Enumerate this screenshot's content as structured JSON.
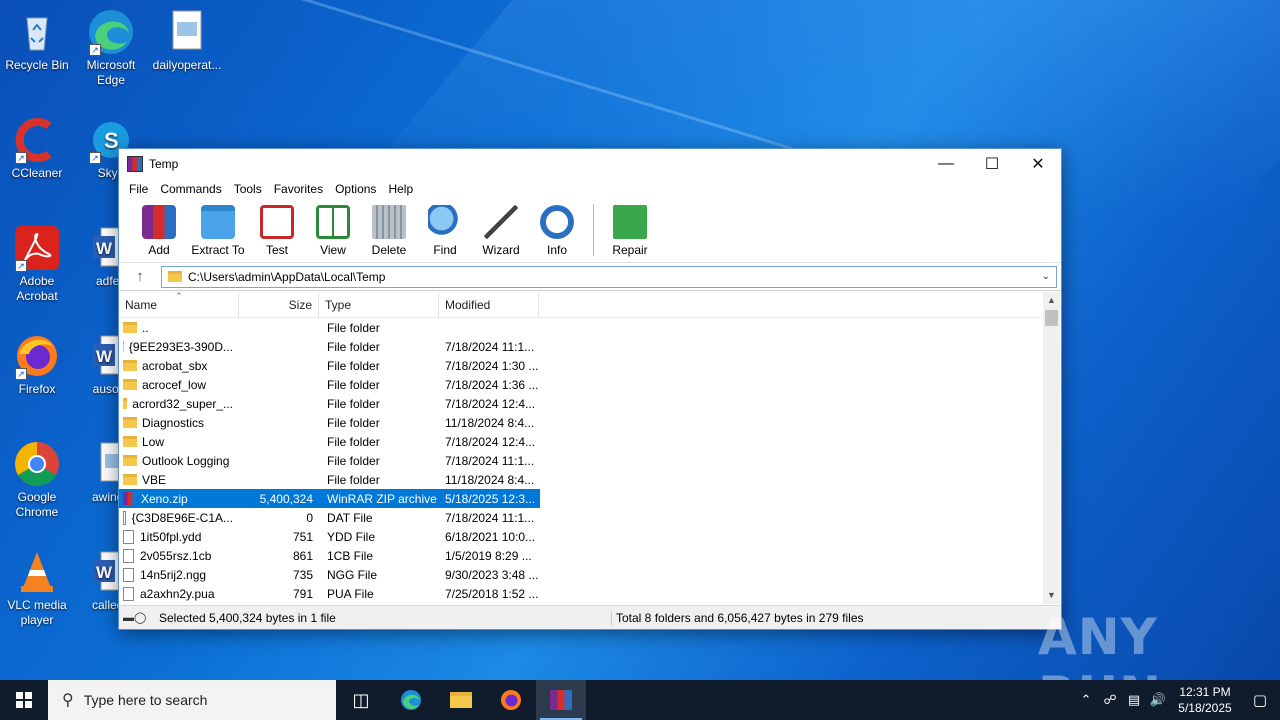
{
  "desktop": {
    "icons": [
      {
        "label": "Recycle Bin",
        "icon": "recycle-bin-icon"
      },
      {
        "label": "Microsoft Edge",
        "icon": "edge-icon"
      },
      {
        "label": "dailyoperat...",
        "icon": "image-file-icon"
      },
      {
        "label": "CCleaner",
        "icon": "ccleaner-icon"
      },
      {
        "label": "Skyp",
        "icon": "skype-icon"
      },
      {
        "label": "Adobe Acrobat",
        "icon": "acrobat-icon"
      },
      {
        "label": "adfee",
        "icon": "word-doc-icon"
      },
      {
        "label": "Firefox",
        "icon": "firefox-icon"
      },
      {
        "label": "ausour",
        "icon": "word-doc-icon"
      },
      {
        "label": "Google Chrome",
        "icon": "chrome-icon"
      },
      {
        "label": "awindo",
        "icon": "image-file-icon"
      },
      {
        "label": "VLC media player",
        "icon": "vlc-icon"
      },
      {
        "label": "calledh",
        "icon": "word-doc-icon"
      }
    ]
  },
  "window": {
    "title": "Temp",
    "menu": [
      "File",
      "Commands",
      "Tools",
      "Favorites",
      "Options",
      "Help"
    ],
    "toolbar": [
      "Add",
      "Extract To",
      "Test",
      "View",
      "Delete",
      "Find",
      "Wizard",
      "Info",
      "Repair"
    ],
    "address": "C:\\Users\\admin\\AppData\\Local\\Temp",
    "columns": {
      "name": "Name",
      "size": "Size",
      "type": "Type",
      "modified": "Modified"
    },
    "rows": [
      {
        "name": "..",
        "size": "",
        "type": "File folder",
        "modified": "",
        "kind": "folder"
      },
      {
        "name": "{9EE293E3-390D...",
        "size": "",
        "type": "File folder",
        "modified": "7/18/2024 11:1...",
        "kind": "folder"
      },
      {
        "name": "acrobat_sbx",
        "size": "",
        "type": "File folder",
        "modified": "7/18/2024 1:30 ...",
        "kind": "folder"
      },
      {
        "name": "acrocef_low",
        "size": "",
        "type": "File folder",
        "modified": "7/18/2024 1:36 ...",
        "kind": "folder"
      },
      {
        "name": "acrord32_super_...",
        "size": "",
        "type": "File folder",
        "modified": "7/18/2024 12:4...",
        "kind": "folder"
      },
      {
        "name": "Diagnostics",
        "size": "",
        "type": "File folder",
        "modified": "11/18/2024 8:4...",
        "kind": "folder"
      },
      {
        "name": "Low",
        "size": "",
        "type": "File folder",
        "modified": "7/18/2024 12:4...",
        "kind": "folder"
      },
      {
        "name": "Outlook Logging",
        "size": "",
        "type": "File folder",
        "modified": "7/18/2024 11:1...",
        "kind": "folder"
      },
      {
        "name": "VBE",
        "size": "",
        "type": "File folder",
        "modified": "11/18/2024 8:4...",
        "kind": "folder"
      },
      {
        "name": "Xeno.zip",
        "size": "5,400,324",
        "type": "WinRAR ZIP archive",
        "modified": "5/18/2025 12:3...",
        "kind": "zip",
        "selected": true
      },
      {
        "name": "{C3D8E96E-C1A...",
        "size": "0",
        "type": "DAT File",
        "modified": "7/18/2024 11:1...",
        "kind": "file"
      },
      {
        "name": "1it50fpl.ydd",
        "size": "751",
        "type": "YDD File",
        "modified": "6/18/2021 10:0...",
        "kind": "file"
      },
      {
        "name": "2v055rsz.1cb",
        "size": "861",
        "type": "1CB File",
        "modified": "1/5/2019 8:29 ...",
        "kind": "file"
      },
      {
        "name": "14n5rij2.ngg",
        "size": "735",
        "type": "NGG File",
        "modified": "9/30/2023 3:48 ...",
        "kind": "file"
      },
      {
        "name": "a2axhn2y.pua",
        "size": "791",
        "type": "PUA File",
        "modified": "7/25/2018 1:52 ...",
        "kind": "file"
      }
    ],
    "status_left": "Selected 5,400,324 bytes in 1 file",
    "status_right": "Total 8 folders and 6,056,427 bytes in 279 files"
  },
  "watermark": "ANY RUN",
  "taskbar": {
    "search_placeholder": "Type here to search",
    "time": "12:31 PM",
    "date": "5/18/2025"
  }
}
